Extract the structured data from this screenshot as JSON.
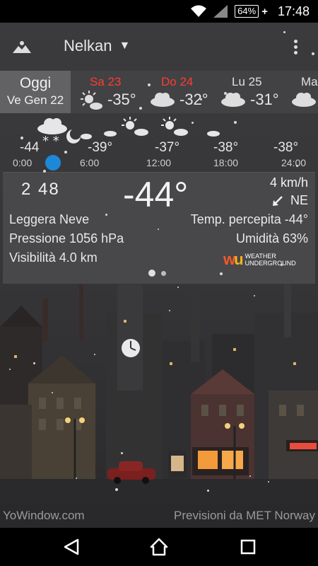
{
  "status_bar": {
    "battery": "64%",
    "time": "17:48",
    "icons": [
      "wifi-icon",
      "signal-icon",
      "battery-charging-icon"
    ]
  },
  "header": {
    "location": "Nelkan"
  },
  "days": [
    {
      "name": "Oggi",
      "date": "Ve Gen 22",
      "selected": true
    },
    {
      "name": "Sa 23",
      "temp": "-35°",
      "icon": "sun-cloud-icon",
      "color": "#ff3b30"
    },
    {
      "name": "Do 24",
      "temp": "-32°",
      "icon": "cloud-icon",
      "color": "#ff3b30"
    },
    {
      "name": "Lu 25",
      "temp": "-31°",
      "icon": "cloud-icon",
      "color": "#e0e0e0"
    },
    {
      "name": "Ma",
      "icon": "cloud-icon",
      "color": "#e0e0e0"
    }
  ],
  "hourly": [
    {
      "time": "0:00",
      "temp": "-44",
      "icon": "snow-cloud-moon-icon"
    },
    {
      "time": "6:00",
      "temp": "-39°",
      "icon": "moon-icon"
    },
    {
      "time": "12:00",
      "temp": "-37°",
      "icon": "sun-cloud-icon"
    },
    {
      "time": "18:00",
      "temp": "-38°",
      "icon": "moon-icon"
    },
    {
      "time": "24:00",
      "temp": "-38°",
      "icon": "moon-icon"
    }
  ],
  "details": {
    "time": "2 48",
    "temperature": "-44°",
    "wind_speed": "4 km/h",
    "wind_dir": "NE",
    "condition": "Leggera Neve",
    "feels_like": "Temp. percepita -44°",
    "pressure": "Pressione 1056 hPa",
    "humidity": "Umidità 63%",
    "visibility": "Visibilità 4.0 km",
    "provider_logo_text": "WEATHER UNDERGROUND",
    "page_count": 2,
    "current_page": 1
  },
  "footer": {
    "left": "YoWindow.com",
    "right": "Previsioni da MET Norway"
  },
  "colors": {
    "weekend": "#ff3b30",
    "timeline_dot": "#1e88d8",
    "wu_orange": "#f05a28",
    "wu_yellow": "#f7b21b"
  }
}
